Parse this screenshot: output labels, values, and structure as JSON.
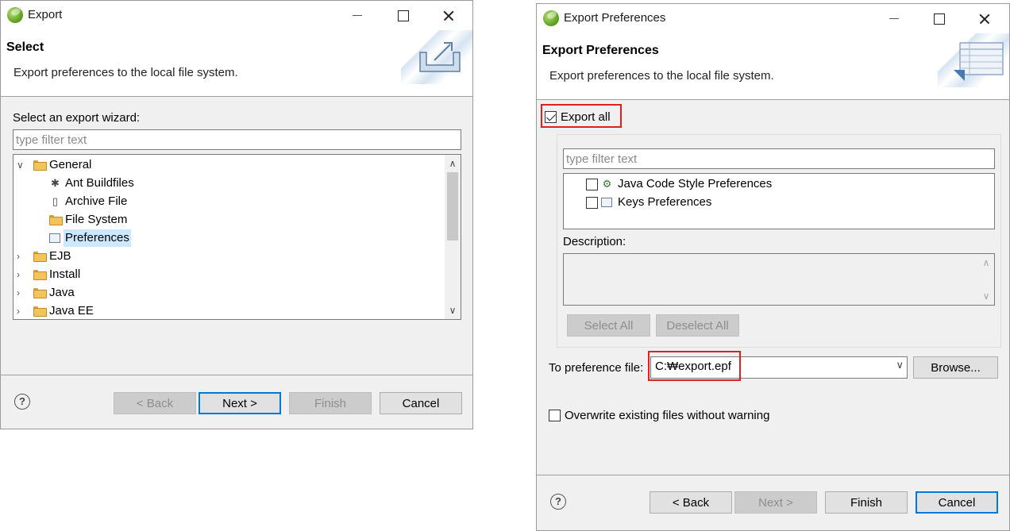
{
  "export_dialog": {
    "title": "Export",
    "banner_title": "Select",
    "banner_desc": "Export preferences to the local file system.",
    "wizard_label": "Select an export wizard:",
    "filter_placeholder": "type filter text",
    "tree": [
      {
        "label": "General",
        "chevron": "∨"
      },
      {
        "label": "Ant Buildfiles",
        "icon": "ant-icon"
      },
      {
        "label": "Archive File",
        "icon": "archive-icon"
      },
      {
        "label": "File System",
        "icon": "folder-icon"
      },
      {
        "label": "Preferences",
        "icon": "preferences-icon",
        "selected": true
      },
      {
        "label": "EJB",
        "chevron": "›"
      },
      {
        "label": "Install",
        "chevron": "›"
      },
      {
        "label": "Java",
        "chevron": "›"
      },
      {
        "label": "Java EE",
        "chevron": "›"
      }
    ],
    "buttons": {
      "back": "< Back",
      "next": "Next >",
      "finish": "Finish",
      "cancel": "Cancel"
    }
  },
  "prefs_dialog": {
    "title": "Export Preferences",
    "banner_title": "Export Preferences",
    "banner_desc": "Export preferences to the local file system.",
    "export_all_label": "Export all",
    "export_all_checked": true,
    "filter_placeholder": "type filter text",
    "items": [
      {
        "label": "Java Code Style Preferences",
        "icon": "java-style-icon",
        "checked": false
      },
      {
        "label": "Keys Preferences",
        "icon": "keys-icon",
        "checked": false
      }
    ],
    "description_label": "Description:",
    "select_all": "Select All",
    "deselect_all": "Deselect All",
    "to_file_label": "To preference file:",
    "file_value": "C:₩export.epf",
    "browse": "Browse...",
    "overwrite_label": "Overwrite existing files without warning",
    "overwrite_checked": false,
    "buttons": {
      "back": "< Back",
      "next": "Next >",
      "finish": "Finish",
      "cancel": "Cancel"
    }
  },
  "colors": {
    "highlight": "#e02020",
    "selection": "#cce8ff",
    "default_button": "#0078d7"
  }
}
